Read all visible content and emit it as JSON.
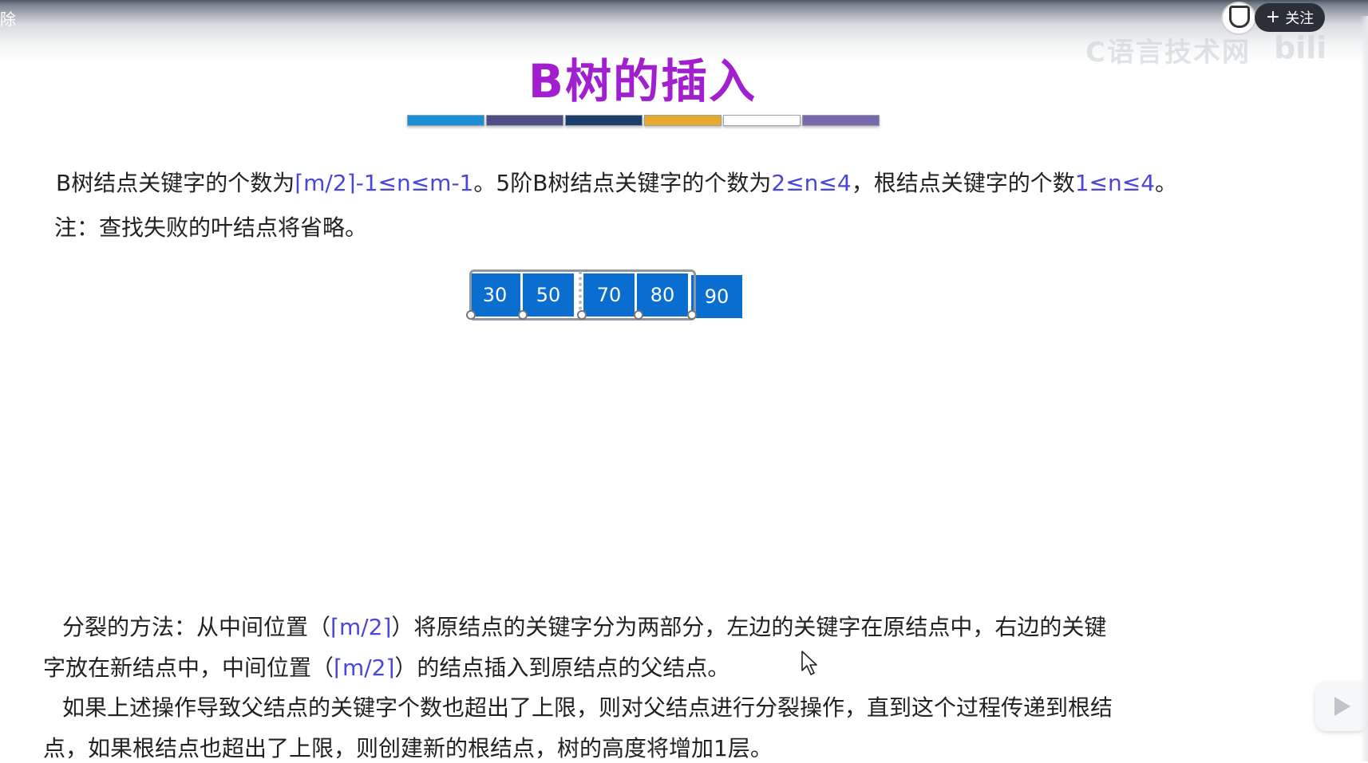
{
  "top_bar": {
    "corner_text": "除",
    "follow_label": "关注"
  },
  "watermark": {
    "text": "C语言技术网",
    "logo": "bili"
  },
  "slide": {
    "title": "B树的插入",
    "colorbar": [
      "#1a8fd6",
      "#4e4d86",
      "#1c3e6b",
      "#e8aa2a",
      "#ffffff",
      "#7869ad"
    ],
    "line1": {
      "a": "B树结点关键字的个数为",
      "b": "⌈m/2⌉-1≤n≤m-1",
      "c": "。5阶B树结点关键字的个数为",
      "d": "2≤n≤4",
      "e": "，根结点关键字的个数",
      "f": "1≤n≤4",
      "g": "。"
    },
    "note": "注：查找失败的叶结点将省略。",
    "node_keys": [
      "30",
      "50",
      "70",
      "80",
      "90"
    ],
    "split": {
      "p1a": "分裂的方法：从中间位置（",
      "p1b": "⌈m/2⌉",
      "p1c": "）将原结点的关键字分为两部分，左边的关键字在原结点中，右边的关键",
      "p2a": "字放在新结点中，中间位置（",
      "p2b": "⌈m/2⌉",
      "p2c": "）的结点插入到原结点的父结点。",
      "p3": "如果上述操作导致父结点的关键字个数也超出了上限，则对父结点进行分裂操作，直到这个过程传递到根结",
      "p4": "点，如果根结点也超出了上限，则创建新的根结点，树的高度将增加1层。"
    }
  },
  "colors": {
    "title": "#a21fd0",
    "highlight": "#4a47d6",
    "key_box": "#0a6ed1"
  }
}
